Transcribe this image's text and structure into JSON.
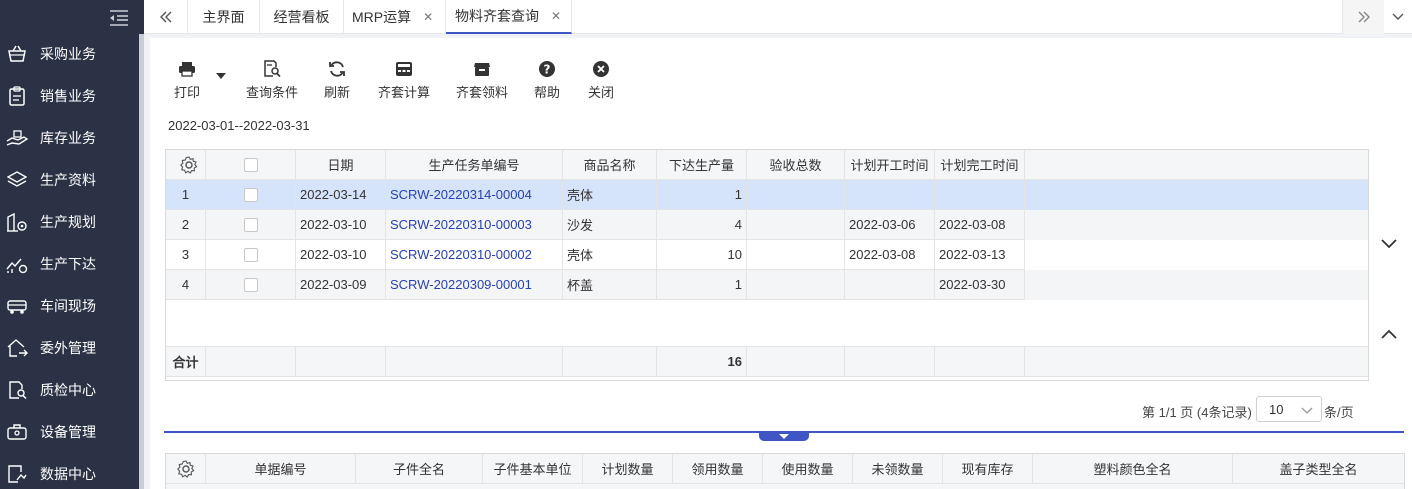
{
  "sidebar": {
    "items": [
      {
        "label": "采购业务",
        "icon": "basket-icon"
      },
      {
        "label": "销售业务",
        "icon": "clipboard-icon"
      },
      {
        "label": "库存业务",
        "icon": "hand-box-icon"
      },
      {
        "label": "生产资料",
        "icon": "layers-icon"
      },
      {
        "label": "生产规划",
        "icon": "building-gear-icon"
      },
      {
        "label": "生产下达",
        "icon": "trend-gear-icon"
      },
      {
        "label": "车间现场",
        "icon": "truck-icon"
      },
      {
        "label": "委外管理",
        "icon": "house-arrow-icon"
      },
      {
        "label": "质检中心",
        "icon": "doc-search-icon"
      },
      {
        "label": "设备管理",
        "icon": "toolbox-icon"
      },
      {
        "label": "数据中心",
        "icon": "chart-box-icon"
      }
    ]
  },
  "tabs": [
    {
      "label": "主界面",
      "closable": false
    },
    {
      "label": "经营看板",
      "closable": false
    },
    {
      "label": "MRP运算",
      "closable": true
    },
    {
      "label": "物料齐套查询",
      "closable": true,
      "active": true
    }
  ],
  "toolbar": {
    "print": "打印",
    "query": "查询条件",
    "refresh": "刷新",
    "calc": "齐套计算",
    "pick": "齐套领料",
    "help": "帮助",
    "close": "关闭"
  },
  "date_range": "2022-03-01--2022-03-31",
  "grid": {
    "headers": [
      "日期",
      "生产任务单编号",
      "商品名称",
      "下达生产量",
      "验收总数",
      "计划开工时间",
      "计划完工时间"
    ],
    "rows": [
      {
        "no": "1",
        "date": "2022-03-14",
        "code": "SCRW-20220314-00004",
        "name": "壳体",
        "qty": "1",
        "accepted": "",
        "start": "",
        "end": ""
      },
      {
        "no": "2",
        "date": "2022-03-10",
        "code": "SCRW-20220310-00003",
        "name": "沙发",
        "qty": "4",
        "accepted": "",
        "start": "2022-03-06",
        "end": "2022-03-08"
      },
      {
        "no": "3",
        "date": "2022-03-10",
        "code": "SCRW-20220310-00002",
        "name": "壳体",
        "qty": "10",
        "accepted": "",
        "start": "2022-03-08",
        "end": "2022-03-13"
      },
      {
        "no": "4",
        "date": "2022-03-09",
        "code": "SCRW-20220309-00001",
        "name": "杯盖",
        "qty": "1",
        "accepted": "",
        "start": "",
        "end": "2022-03-30"
      }
    ],
    "footer_label": "合计",
    "footer_qty": "16"
  },
  "pager": {
    "info": "第 1/1 页 (4条记录)",
    "page_size": "10",
    "suffix": "条/页"
  },
  "detail": {
    "headers": [
      "单据编号",
      "子件全名",
      "子件基本单位",
      "计划数量",
      "领用数量",
      "使用数量",
      "未领数量",
      "现有库存",
      "塑料颜色全名",
      "盖子类型全名"
    ]
  },
  "colors": {
    "sidebar_bg": "#2b3245",
    "accent": "#3f57c4",
    "link": "#2840b5",
    "selected_row": "#d6e4fb"
  }
}
